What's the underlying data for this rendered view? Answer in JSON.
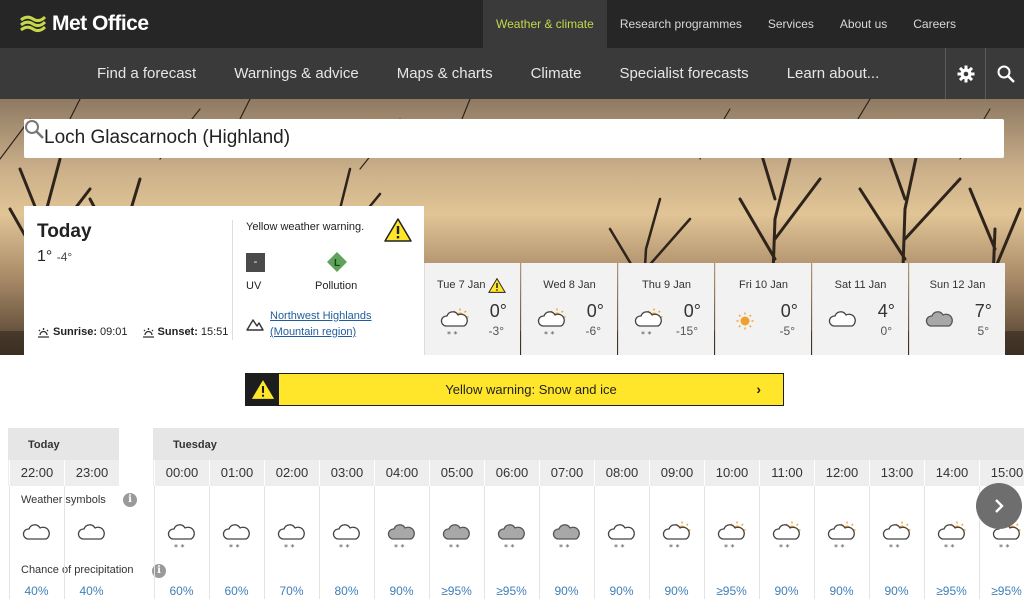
{
  "brand": {
    "name": "Met Office"
  },
  "top_nav": [
    {
      "label": "Weather & climate",
      "active": true
    },
    {
      "label": "Research programmes",
      "active": false
    },
    {
      "label": "Services",
      "active": false
    },
    {
      "label": "About us",
      "active": false
    },
    {
      "label": "Careers",
      "active": false
    }
  ],
  "main_nav": [
    {
      "label": "Find a forecast"
    },
    {
      "label": "Warnings & advice"
    },
    {
      "label": "Maps & charts"
    },
    {
      "label": "Climate"
    },
    {
      "label": "Specialist forecasts"
    },
    {
      "label": "Learn about..."
    }
  ],
  "icons": {
    "settings": "gear-icon",
    "search": "search-icon"
  },
  "search": {
    "value": "Loch Glascarnoch (Highland)"
  },
  "today": {
    "title": "Today",
    "max": "1°",
    "min": "-4°",
    "sunrise_label": "Sunrise:",
    "sunrise": "09:01",
    "sunset_label": "Sunset:",
    "sunset": "15:51",
    "warning": "Yellow weather warning.",
    "uv_label": "UV",
    "uv_value": "-",
    "pollution_label": "Pollution",
    "pollution_value": "L",
    "region_line1": "Northwest Highlands",
    "region_line2": "(Mountain region)"
  },
  "days": [
    {
      "label": "Tue 7 Jan",
      "max": "0°",
      "min": "-3°",
      "icon": "sunny-intervals-snow",
      "warning": true
    },
    {
      "label": "Wed 8 Jan",
      "max": "0°",
      "min": "-6°",
      "icon": "sunny-intervals-snow",
      "warning": false
    },
    {
      "label": "Thu 9 Jan",
      "max": "0°",
      "min": "-15°",
      "icon": "sunny-intervals-snow",
      "warning": false
    },
    {
      "label": "Fri 10 Jan",
      "max": "0°",
      "min": "-5°",
      "icon": "sunny",
      "warning": false
    },
    {
      "label": "Sat 11 Jan",
      "max": "4°",
      "min": "0°",
      "icon": "cloud",
      "warning": false
    },
    {
      "label": "Sun 12 Jan",
      "max": "7°",
      "min": "5°",
      "icon": "grey-cloud",
      "warning": false
    }
  ],
  "banner": {
    "text": "Yellow warning: Snow and ice",
    "arrow": "›"
  },
  "hourly": {
    "today_label": "Today",
    "tuesday_label": "Tuesday",
    "symbols_label": "Weather symbols",
    "precip_label": "Chance of precipitation",
    "info": "i",
    "today_hours": [
      {
        "time": "22:00",
        "icon": "cloud",
        "precip": "40%"
      },
      {
        "time": "23:00",
        "icon": "cloud",
        "precip": "40%"
      }
    ],
    "tuesday_hours": [
      {
        "time": "00:00",
        "icon": "cloud-snow",
        "precip": "60%"
      },
      {
        "time": "01:00",
        "icon": "cloud-snow",
        "precip": "60%"
      },
      {
        "time": "02:00",
        "icon": "cloud-snow",
        "precip": "70%"
      },
      {
        "time": "03:00",
        "icon": "cloud-snow",
        "precip": "80%"
      },
      {
        "time": "04:00",
        "icon": "grey-cloud-snow",
        "precip": "90%"
      },
      {
        "time": "05:00",
        "icon": "grey-cloud-snow",
        "precip": "≥95%"
      },
      {
        "time": "06:00",
        "icon": "grey-cloud-snow",
        "precip": "≥95%"
      },
      {
        "time": "07:00",
        "icon": "grey-cloud-snow",
        "precip": "90%"
      },
      {
        "time": "08:00",
        "icon": "cloud-snow",
        "precip": "90%"
      },
      {
        "time": "09:00",
        "icon": "sun-cloud-snow",
        "precip": "90%"
      },
      {
        "time": "10:00",
        "icon": "sun-cloud-snow",
        "precip": "≥95%"
      },
      {
        "time": "11:00",
        "icon": "sun-cloud-snow",
        "precip": "90%"
      },
      {
        "time": "12:00",
        "icon": "sun-cloud-snow",
        "precip": "90%"
      },
      {
        "time": "13:00",
        "icon": "sun-cloud-snow",
        "precip": "90%"
      },
      {
        "time": "14:00",
        "icon": "sun-cloud-snow",
        "precip": "≥95%"
      },
      {
        "time": "15:00",
        "icon": "sun-cloud-snow",
        "precip": "≥95%"
      }
    ]
  },
  "colors": {
    "accent": "#c6d84a",
    "warning": "#ffe62a",
    "link": "#1f5e9e",
    "precip": "#3f7fb8",
    "sun": "#f0a030"
  }
}
